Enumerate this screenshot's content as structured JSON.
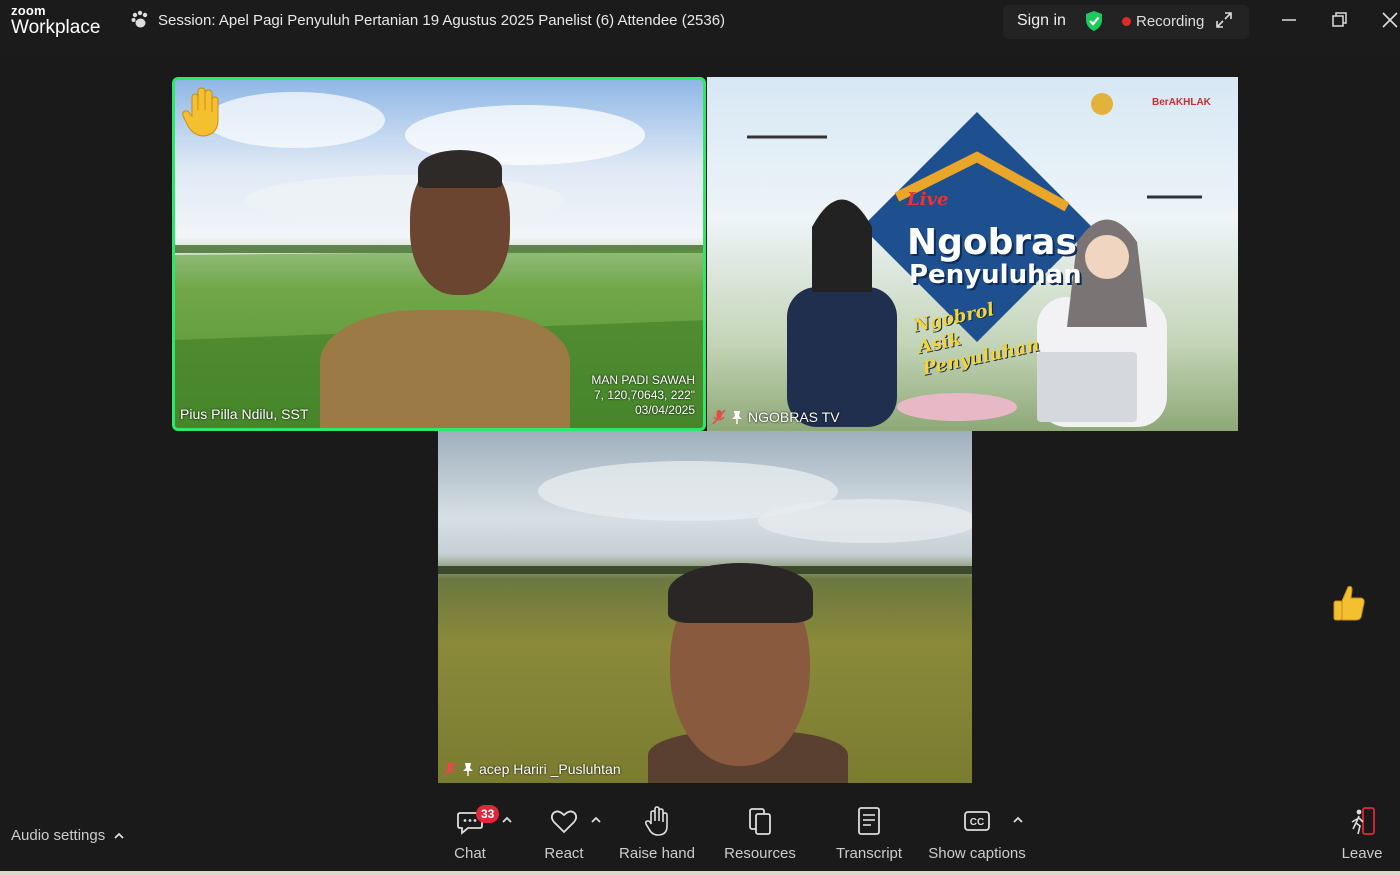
{
  "app": {
    "logo_top": "zoom",
    "logo_bottom": "Workplace"
  },
  "session_title": "Session: Apel Pagi Penyuluh Pertanian 19 Agustus 2025 Panelist (6) Attendee (2536)",
  "header": {
    "sign_in": "Sign in",
    "recording": "Recording"
  },
  "tiles": [
    {
      "name": "Pius Pilla Ndilu, SST",
      "stamp_line1": "MAN PADI SAWAH",
      "stamp_line2": "7, 120,70643, 222\"",
      "stamp_line3": "03/04/2025",
      "hand_raised": true,
      "active_speaker": true
    },
    {
      "name": "NGOBRAS TV",
      "banner_title": "Ngobras",
      "banner_sub": "Penyuluhan",
      "banner_tag": "Ngobrol Asik Penyuluhan",
      "banner_live": "Live",
      "brand": "BerAKHLAK",
      "muted": true
    },
    {
      "name": "acep Hariri _Pusluhtan",
      "muted": true
    }
  ],
  "toolbar": {
    "audio_settings": "Audio settings",
    "chat": "Chat",
    "chat_badge": "33",
    "react": "React",
    "raise_hand": "Raise hand",
    "resources": "Resources",
    "transcript": "Transcript",
    "show_captions": "Show captions",
    "leave": "Leave"
  },
  "colors": {
    "active_speaker_border": "#2ee86b",
    "recording_dot": "#e02a2a",
    "badge": "#e0283a"
  }
}
